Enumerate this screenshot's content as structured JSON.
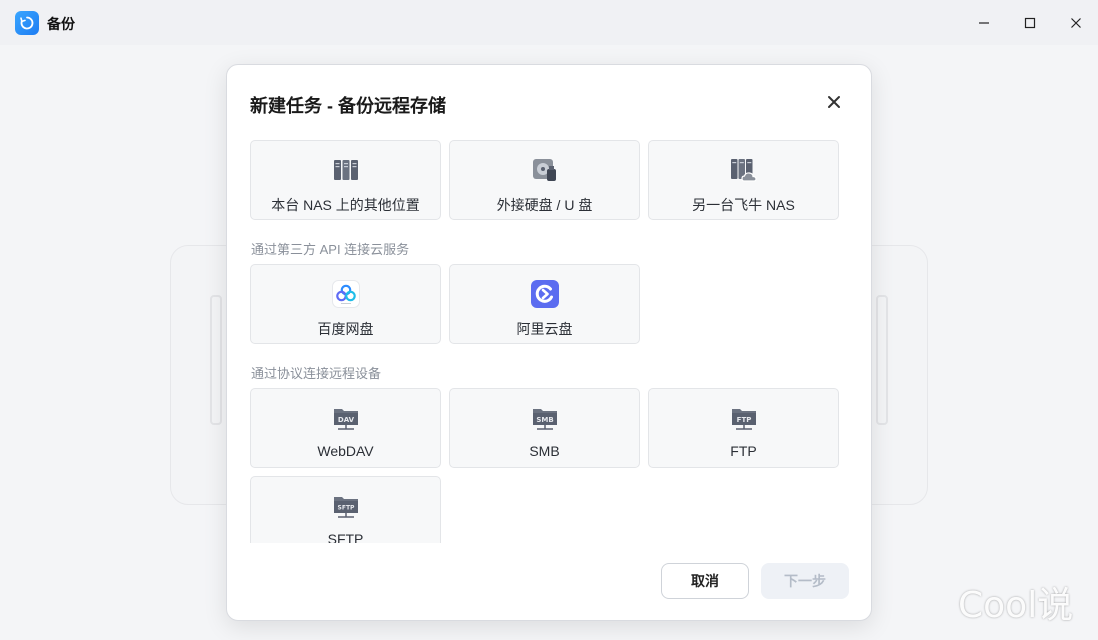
{
  "window": {
    "title": "备份",
    "controls": [
      "minimize",
      "maximize",
      "close"
    ]
  },
  "dialog": {
    "title": "新建任务 - 备份远程存储",
    "local_options": [
      {
        "label": "本台 NAS 上的其他位置",
        "icon": "server-rack-icon"
      },
      {
        "label": "外接硬盘 / U 盘",
        "icon": "external-drive-icon"
      },
      {
        "label": "另一台飞牛 NAS",
        "icon": "server-cloud-icon"
      }
    ],
    "cloud_section_label": "通过第三方 API 连接云服务",
    "cloud_options": [
      {
        "label": "百度网盘",
        "icon": "baidu-netdisk-icon"
      },
      {
        "label": "阿里云盘",
        "icon": "aliyun-drive-icon"
      }
    ],
    "protocol_section_label": "通过协议连接远程设备",
    "protocol_options": [
      {
        "label": "WebDAV",
        "icon": "webdav-folder-icon",
        "badge": "DAV"
      },
      {
        "label": "SMB",
        "icon": "smb-folder-icon",
        "badge": "SMB"
      },
      {
        "label": "FTP",
        "icon": "ftp-folder-icon",
        "badge": "FTP"
      },
      {
        "label": "SFTP",
        "icon": "sftp-folder-icon",
        "badge": "SFTP"
      }
    ],
    "cancel_label": "取消",
    "next_label": "下一步",
    "next_enabled": false
  },
  "watermark": "Cool说",
  "colors": {
    "accent": "#1d7cf2",
    "aliyun": "#5b6cf0",
    "icon_gray": "#5a6170"
  }
}
